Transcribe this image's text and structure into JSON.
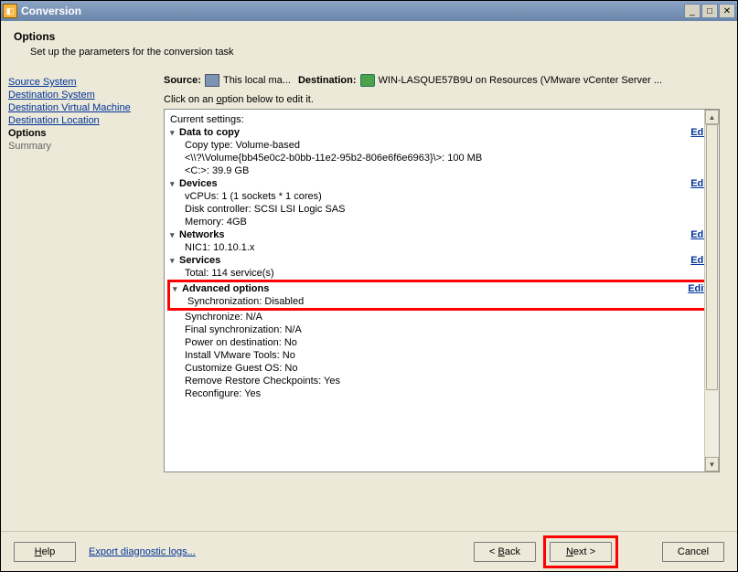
{
  "titlebar": {
    "title": "Conversion"
  },
  "header": {
    "title": "Options",
    "subtitle": "Set up the parameters for the conversion task"
  },
  "sidebar": {
    "items": [
      {
        "label": "Source System",
        "type": "link"
      },
      {
        "label": "Destination System",
        "type": "link"
      },
      {
        "label": "Destination Virtual Machine",
        "type": "link"
      },
      {
        "label": "Destination Location",
        "type": "link"
      },
      {
        "label": "Options",
        "type": "current"
      },
      {
        "label": "Summary",
        "type": "plain"
      }
    ]
  },
  "top": {
    "source_label": "Source:",
    "source_value": "This local ma...",
    "dest_label": "Destination:",
    "dest_value": "WIN-LASQUE57B9U on Resources (VMware vCenter Server ...",
    "hint_pre": "Click on an ",
    "hint_u": "o",
    "hint_post": "ption below to edit it."
  },
  "settings": {
    "current": "Current settings:",
    "edit": "Edit",
    "data_to_copy": {
      "title": "Data to copy",
      "lines": [
        "Copy type: Volume-based",
        "<\\\\?\\Volume{bb45e0c2-b0bb-11e2-95b2-806e6f6e6963}\\>: 100 MB",
        "<C:>: 39.9 GB"
      ]
    },
    "devices": {
      "title": "Devices",
      "lines": [
        "vCPUs: 1 (1 sockets * 1 cores)",
        "Disk controller: SCSI LSI Logic SAS",
        "Memory: 4GB"
      ]
    },
    "networks": {
      "title": "Networks",
      "lines": [
        "NIC1: 10.10.1.x"
      ]
    },
    "services": {
      "title": "Services",
      "lines": [
        "Total: 114 service(s)"
      ]
    },
    "advanced": {
      "title": "Advanced options",
      "highlighted_line": "Synchronization: Disabled",
      "lines": [
        "Synchronize: N/A",
        "Final synchronization: N/A",
        "Power on destination: No",
        "Install VMware Tools: No",
        "Customize Guest OS: No",
        "Remove Restore Checkpoints: Yes",
        "Reconfigure: Yes"
      ]
    }
  },
  "footer": {
    "help": "Help",
    "export": "Export diagnostic logs...",
    "back": "< Back",
    "next": "Next >",
    "cancel": "Cancel"
  }
}
